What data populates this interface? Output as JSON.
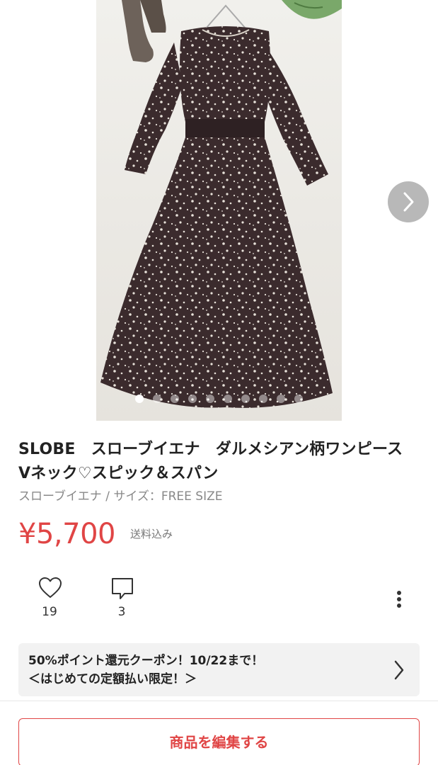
{
  "item": {
    "title": "SLOBE　スローブイエナ　ダルメシアン柄ワンピース　Vネック♡スピック＆スパン",
    "subtitle": "スローブイエナ / サイズ：FREE SIZE",
    "price": "¥5,700",
    "shipping": "送料込み"
  },
  "gallery": {
    "image_label": "product-photo-dress",
    "dot_count": 10,
    "active_index": 0
  },
  "actions": {
    "likes": "19",
    "comments": "3"
  },
  "coupon": {
    "line1": "50%ポイント還元クーポン！10/22まで！",
    "line2": "＜はじめての定額払い限定！＞"
  },
  "buttons": {
    "edit": "商品を編集する"
  },
  "colors": {
    "accent": "#e04545",
    "dress": "#3a2a2c",
    "background": "#ffffff"
  }
}
